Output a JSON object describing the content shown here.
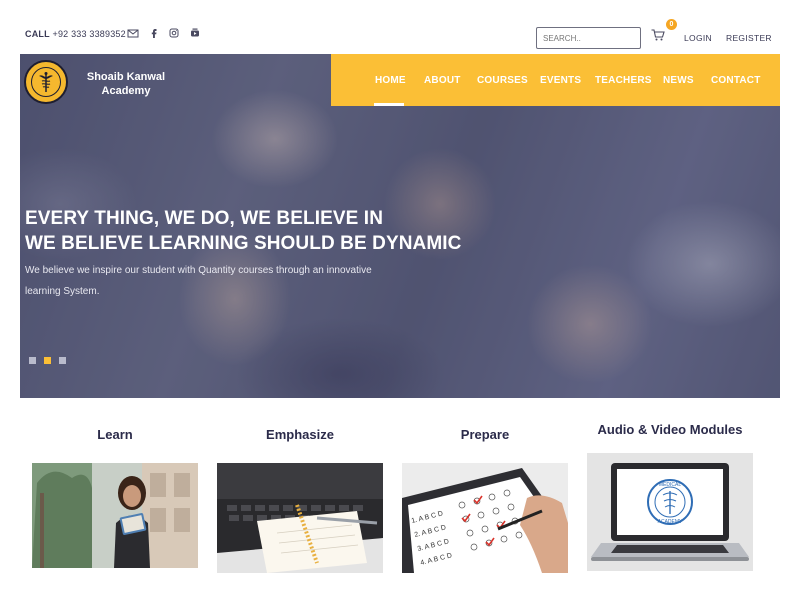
{
  "topbar": {
    "call_label": "CALL",
    "phone": "+92 333 3389352",
    "social_icons": [
      "mail-icon",
      "facebook-icon",
      "instagram-icon",
      "youtube-icon"
    ],
    "search_placeholder": "SEARCH..",
    "cart_count": "0",
    "login": "LOGIN",
    "register": "REGISTER"
  },
  "brand": {
    "name_line1": "Shoaib Kanwal",
    "name_line2": "Academy",
    "logo_ring_text": "Shoaib Kanwal Academy"
  },
  "nav": {
    "items": [
      "HOME",
      "ABOUT",
      "COURSES",
      "EVENTS",
      "TEACHERS",
      "NEWS",
      "CONTACT"
    ],
    "active": "HOME"
  },
  "hero": {
    "headline_line1": "EVERY THING, WE DO, WE BELIEVE IN",
    "headline_line2": "WE BELIEVE LEARNING SHOULD BE DYNAMIC",
    "body_line1": "We believe we inspire our student with Quantity courses through an innovative",
    "body_line2": "learning System.",
    "slides": 3,
    "active_slide": 2
  },
  "cards": [
    {
      "title": "Learn",
      "image": "woman-reading-book"
    },
    {
      "title": "Emphasize",
      "image": "laptop-notebook"
    },
    {
      "title": "Prepare",
      "image": "answer-sheet-test"
    },
    {
      "title": "Audio & Video Modules",
      "image": "laptop-medical-academy",
      "screen_text": "MEDICAL ACADEMY"
    }
  ],
  "colors": {
    "accent": "#fbbf36",
    "badge": "#f5a623",
    "heading": "#2b2b4a",
    "hero_overlay": "#373a5f"
  }
}
